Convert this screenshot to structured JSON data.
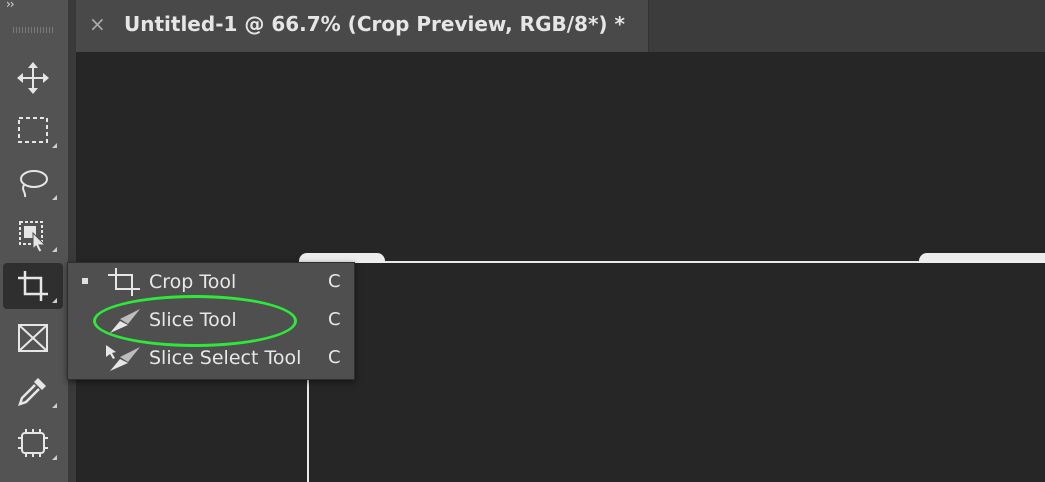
{
  "document": {
    "tab_title": "Untitled-1 @ 66.7% (Crop Preview, RGB/8*) *",
    "close_glyph": "×"
  },
  "toolbar": {
    "expand_glyph": "››",
    "tools": [
      {
        "name": "move-tool",
        "icon": "move-icon"
      },
      {
        "name": "marquee-tool",
        "icon": "rectangular-marquee-icon"
      },
      {
        "name": "lasso-tool",
        "icon": "lasso-icon"
      },
      {
        "name": "object-selection-tool",
        "icon": "object-selection-icon"
      },
      {
        "name": "crop-tool",
        "icon": "crop-icon",
        "active": true
      },
      {
        "name": "frame-tool",
        "icon": "frame-icon"
      },
      {
        "name": "eyedropper-tool",
        "icon": "eyedropper-icon"
      },
      {
        "name": "spot-healing-tool",
        "icon": "bandage-icon"
      }
    ]
  },
  "flyout": {
    "items": [
      {
        "label": "Crop Tool",
        "shortcut": "C",
        "icon": "crop-icon",
        "selected": true
      },
      {
        "label": "Slice Tool",
        "shortcut": "C",
        "icon": "slice-icon",
        "selected": false
      },
      {
        "label": "Slice Select Tool",
        "shortcut": "C",
        "icon": "slice-select-icon",
        "selected": false
      }
    ]
  },
  "colors": {
    "highlight": "#2ee83a",
    "toolbar_bg": "#535353",
    "canvas_bg": "#262626",
    "menu_bg": "#4f4f4f"
  }
}
